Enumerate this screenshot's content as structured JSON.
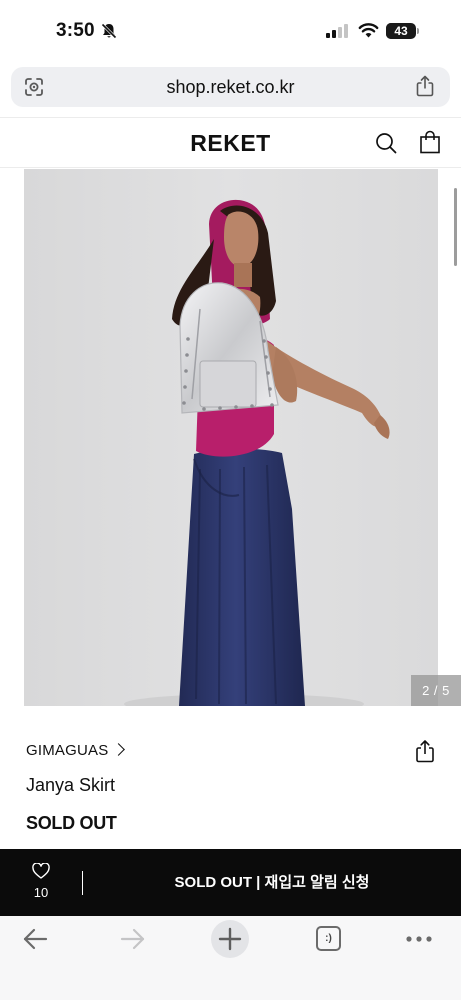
{
  "status_bar": {
    "time": "3:50",
    "battery_level": "43"
  },
  "browser": {
    "url": "shop.reket.co.kr"
  },
  "site": {
    "logo": "REKET",
    "icons": [
      "search-icon",
      "shopping-bag-icon"
    ]
  },
  "gallery": {
    "counter": "2 / 5",
    "current_index": 2,
    "total": 5
  },
  "product": {
    "brand": "GIMAGUAS",
    "name": "Janya Skirt",
    "status": "SOLD OUT"
  },
  "buy_bar": {
    "like_count": "10",
    "action_label": "SOLD OUT | 재입고 알림 신청"
  },
  "toolbar": {
    "icons": [
      "back-arrow-icon",
      "forward-arrow-icon",
      "plus-icon",
      "tabs-icon",
      "more-icon"
    ],
    "tabs_glyph": ":)"
  },
  "colors": {
    "buy_bar": "#0b0b0b",
    "url_bar": "#eeeff2",
    "photo_background": "#dcdcdd",
    "top_magenta": "#b81f6b",
    "skirt_navy": "#2c3566"
  }
}
